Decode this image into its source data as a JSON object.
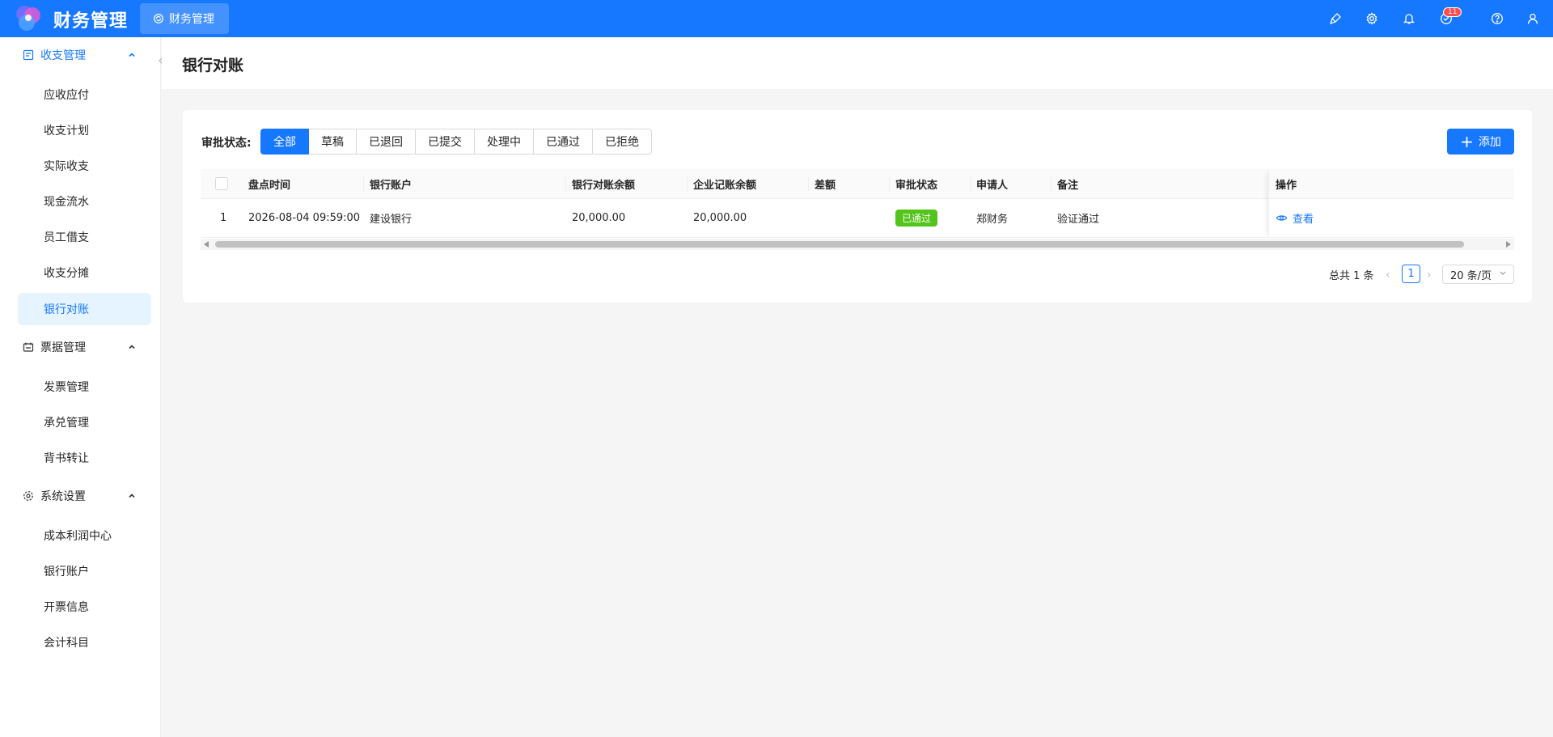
{
  "header": {
    "app_title": "财务管理",
    "app_tab_label": "财务管理",
    "notification_count": "11",
    "colors": {
      "primary": "#1677ff",
      "badge": "#ff4d4f",
      "success": "#52c41a"
    }
  },
  "sidebar": {
    "groups": [
      {
        "label": "收支管理",
        "items": [
          "应收应付",
          "收支计划",
          "实际收支",
          "现金流水",
          "员工借支",
          "收支分摊",
          "银行对账"
        ]
      },
      {
        "label": "票据管理",
        "items": [
          "发票管理",
          "承兑管理",
          "背书转让"
        ]
      },
      {
        "label": "系统设置",
        "items": [
          "成本利润中心",
          "银行账户",
          "开票信息",
          "会计科目"
        ]
      }
    ],
    "active_item": "银行对账"
  },
  "page": {
    "title": "银行对账"
  },
  "filter": {
    "label": "审批状态:",
    "options": [
      "全部",
      "草稿",
      "已退回",
      "已提交",
      "处理中",
      "已通过",
      "已拒绝"
    ],
    "selected": "全部"
  },
  "toolbar": {
    "add_label": "添加"
  },
  "table": {
    "columns": [
      "盘点时间",
      "银行账户",
      "银行对账余额",
      "企业记账余额",
      "差额",
      "审批状态",
      "申请人",
      "备注",
      "操作"
    ],
    "rows": [
      {
        "index": "1",
        "time": "2026-08-04 09:59:00",
        "account": "建设银行",
        "bank_balance": "20,000.00",
        "book_balance": "20,000.00",
        "diff": "",
        "status": "已通过",
        "applicant": "郑财务",
        "remark": "验证通过",
        "action": "查看"
      }
    ]
  },
  "pagination": {
    "total_text": "总共 1 条",
    "current_page": "1",
    "page_size": "20 条/页"
  }
}
